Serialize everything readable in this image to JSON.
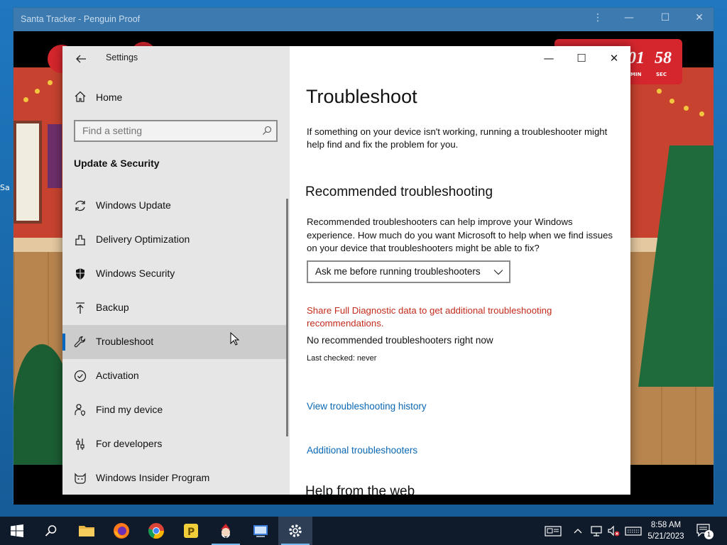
{
  "santa_window": {
    "title": "Santa Tracker - Penguin Proof",
    "counter": [
      {
        "value": "01",
        "unit": "MIN"
      },
      {
        "value": "58",
        "unit": "SEC"
      }
    ],
    "desktop_label": "Sa"
  },
  "settings": {
    "app_title": "Settings",
    "home_label": "Home",
    "search_placeholder": "Find a setting",
    "section_title": "Update & Security",
    "nav_items": [
      {
        "label": "Windows Update",
        "icon": "refresh-icon"
      },
      {
        "label": "Delivery Optimization",
        "icon": "delivery-icon"
      },
      {
        "label": "Windows Security",
        "icon": "shield-icon"
      },
      {
        "label": "Backup",
        "icon": "backup-arrow-icon"
      },
      {
        "label": "Troubleshoot",
        "icon": "wrench-icon",
        "selected": true
      },
      {
        "label": "Activation",
        "icon": "check-circle-icon"
      },
      {
        "label": "Find my device",
        "icon": "person-location-icon"
      },
      {
        "label": "For developers",
        "icon": "developer-sliders-icon"
      },
      {
        "label": "Windows Insider Program",
        "icon": "insider-cat-icon"
      }
    ],
    "content": {
      "title": "Troubleshoot",
      "intro": "If something on your device isn't working, running a troubleshooter might help find and fix the problem for you.",
      "recommended_heading": "Recommended troubleshooting",
      "recommended_desc": "Recommended troubleshooters can help improve your Windows experience. How much do you want Microsoft to help when we find issues on your device that troubleshooters might be able to fix?",
      "dropdown_value": "Ask me before running troubleshooters",
      "diagnostic_link": "Share Full Diagnostic data to get additional troubleshooting recommendations.",
      "no_recommended": "No recommended troubleshooters right now",
      "last_checked": "Last checked: never",
      "history_link": "View troubleshooting history",
      "additional_link": "Additional troubleshooters",
      "help_heading": "Help from the web"
    }
  },
  "taskbar": {
    "time": "8:58 AM",
    "date": "5/21/2023",
    "notification_count": "1",
    "apps": [
      "start-icon",
      "search-icon",
      "file-explorer-icon",
      "firefox-icon",
      "chrome-icon",
      "pdf-app-icon",
      "santa-app-icon",
      "network-app-icon",
      "settings-gear-icon"
    ]
  }
}
